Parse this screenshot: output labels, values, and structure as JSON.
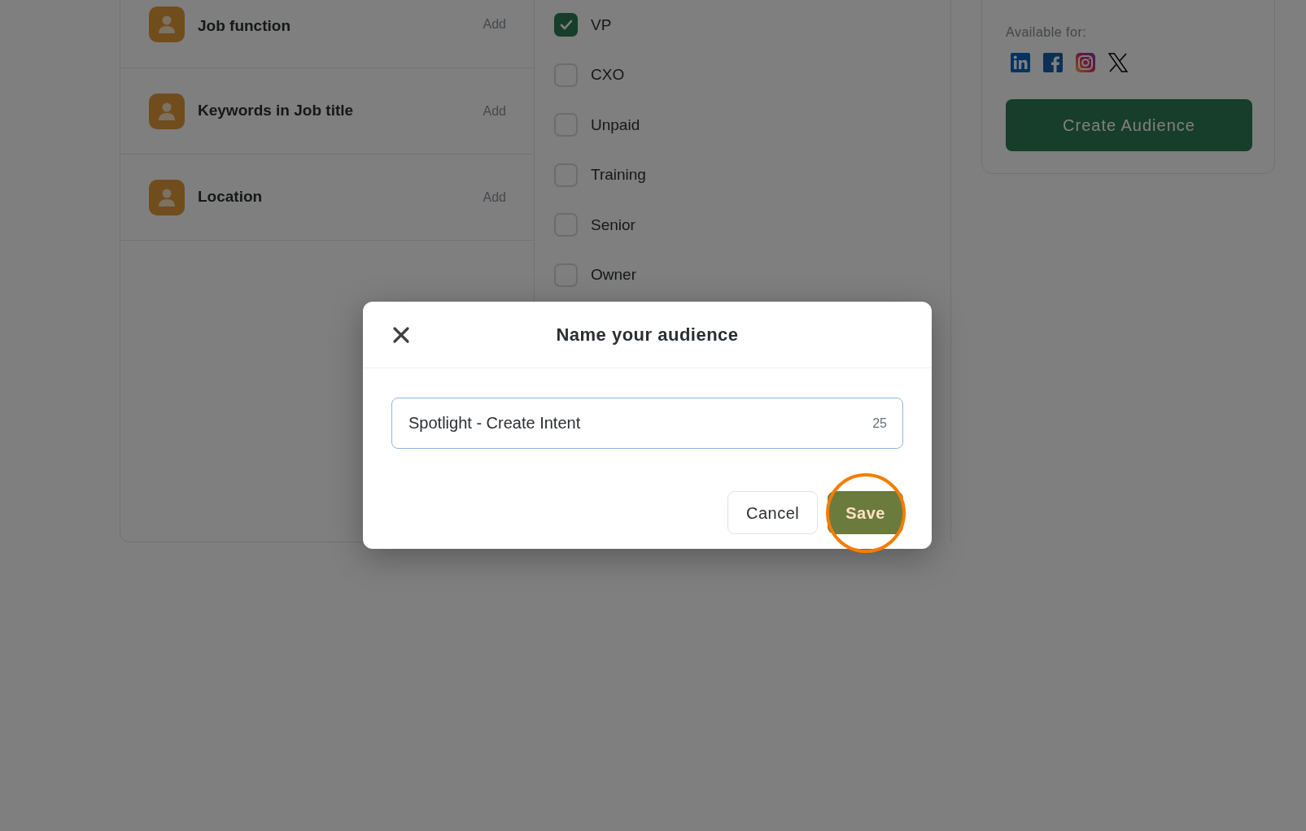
{
  "filters": [
    {
      "label": "Job function",
      "action": "Add"
    },
    {
      "label": "Keywords in Job title",
      "action": "Add"
    },
    {
      "label": "Location",
      "action": "Add"
    }
  ],
  "options": [
    {
      "label": "VP",
      "checked": true
    },
    {
      "label": "CXO",
      "checked": false
    },
    {
      "label": "Unpaid",
      "checked": false
    },
    {
      "label": "Training",
      "checked": false
    },
    {
      "label": "Senior",
      "checked": false
    },
    {
      "label": "Owner",
      "checked": false
    }
  ],
  "summary": {
    "available_label": "Available for:",
    "platforms": [
      {
        "kind": "linkedin"
      },
      {
        "kind": "facebook"
      },
      {
        "kind": "instagram"
      },
      {
        "kind": "x"
      }
    ],
    "button": "Create Audience"
  },
  "dialog": {
    "title": "Name your audience",
    "name_value": "Spotlight - Create Intent",
    "char_count": "25",
    "buttons": [
      {
        "label": "Cancel",
        "kind": "secondary",
        "highlighted": false
      },
      {
        "label": "Save",
        "kind": "primary",
        "highlighted": true
      }
    ]
  }
}
